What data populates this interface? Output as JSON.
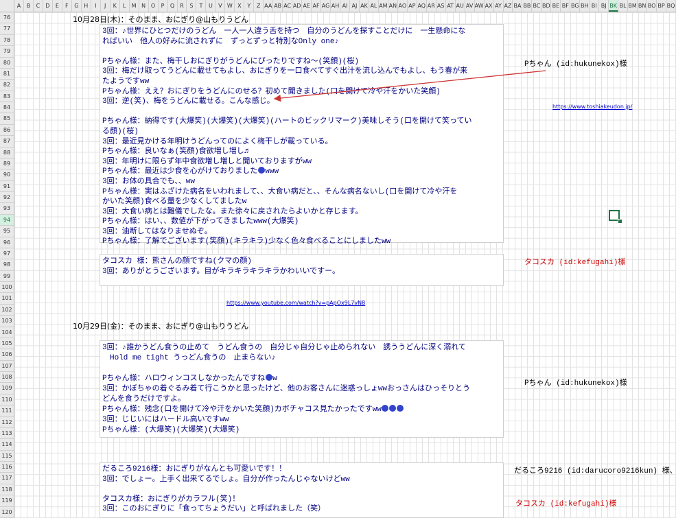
{
  "colors": {
    "accent": "#217346",
    "text_blue": "#000080",
    "name_red": "#cc0000",
    "link": "#0000cc",
    "arrow": "#cc3333"
  },
  "columns": [
    "A",
    "B",
    "C",
    "D",
    "E",
    "F",
    "G",
    "H",
    "I",
    "J",
    "K",
    "L",
    "M",
    "N",
    "O",
    "P",
    "Q",
    "R",
    "S",
    "T",
    "U",
    "V",
    "W",
    "X",
    "Y",
    "Z",
    "AA",
    "AB",
    "AC",
    "AD",
    "AE",
    "AF",
    "AG",
    "AH",
    "AI",
    "AJ",
    "AK",
    "AL",
    "AM",
    "AN",
    "AO",
    "AP",
    "AQ",
    "AR",
    "AS",
    "AT",
    "AU",
    "AV",
    "AW",
    "AX",
    "AY",
    "AZ",
    "BA",
    "BB",
    "BC",
    "BD",
    "BE",
    "BF",
    "BG",
    "BH",
    "BI",
    "BJ",
    "BK",
    "BL",
    "BM",
    "BN",
    "BO",
    "BP",
    "BQ"
  ],
  "selected_column": "BK",
  "rows": [
    "76",
    "77",
    "78",
    "79",
    "80",
    "81",
    "82",
    "83",
    "84",
    "85",
    "86",
    "87",
    "88",
    "89",
    "90",
    "91",
    "92",
    "93",
    "94",
    "95",
    "96",
    "97",
    "98",
    "99",
    "100",
    "101",
    "102",
    "103",
    "104",
    "105",
    "106",
    "107",
    "108",
    "109",
    "110",
    "111",
    "112",
    "113",
    "114",
    "115",
    "116",
    "117",
    "118",
    "119",
    "120"
  ],
  "selected_row": "94",
  "headings": {
    "day1": "10月28日(木)：そのまま、おにぎり@山もりうどん",
    "day2": "10月29日(金)：そのまま、おにぎり@山もりうどん"
  },
  "block1": [
    "3回：♪世界にひとつだけのうどん　一人一人違う舌を持つ　自分のうどんを探すことだけに　一生懸命にな",
    "ればいい　他人の好みに流されずに　ずっとずっと特別なOnly one♪",
    "",
    "Pちゃん様：また、梅干しおにぎりがうどんにぴったりですね～(笑顔)(桜)",
    "3回：梅だけ取ってうどんに載せてもよし、おにぎりを一口食べてすぐ出汁を流し込んでもよし、もう春が来",
    "たようですww",
    "Pちゃん様：ええ？おにぎりをうどんにのせる？初めて聞きました(口を開けて冷や汗をかいた笑顔)",
    "3回：逆(笑)、梅をうどんに載せる。こんな感じ。",
    "",
    "Pちゃん様：納得です(大爆笑)(大爆笑)(大爆笑)(ハートのビックリマーク)美味しそう(口を開けて笑ってい",
    "る顔)(桜)",
    "3回：最近見かける年明けうどんってのによく梅干しが載っている。",
    "Pちゃん様：良いなぁ(笑顔)食欲増し増し♬",
    "3回：年明けに限らず年中食欲増し増しと聞いておりますがww",
    "Pちゃん様：最近は少食を心がけておりました{emo}www",
    "3回：お体の具合でも、、ww",
    "Pちゃん様：実はふざけた病名をいわれまして、、大食い病だと、、そんな病名ないし(口を開けて冷や汗を",
    "かいた笑顔)食べる量を少なくしてましたw",
    "3回：大食い病とは難儀でしたな。また徐々に戻されたらよいかと存じます。",
    "Pちゃん様：はい、、数値が下がってきましたwww(大爆笑)",
    "3回：油断してはなりませぬぞ。",
    "Pちゃん様：了解でございます(笑顔)(キラキラ)少なく色々食べることにしましたww"
  ],
  "block2": [
    "タコスカ 様：熊さんの顔ですね(クマの顔)",
    "3回：ありがとうございます。目がキラキラキラキラかわいいですー。"
  ],
  "block3": [
    "3回：♪誰かうどん食うの止めて　うどん食うの　自分じゃ自分じゃ止められない　誘ううどんに深く溺れて",
    "　Hold me tight うっどん食うの　止まらない♪",
    "",
    "Pちゃん様：ハロウィンコスしなかったんですね{emo}w",
    "3回：かぼちゃの着ぐるみ着て行こうかと思ったけど、他のお客さんに迷惑っしょwwおっさんはひっそりとう",
    "どんを食うだけですよ。",
    "Pちゃん様：残念(口を開けて冷や汗をかいた笑顔)カボチャコス見たかったですww{emo}{emo}{emo}",
    "3回：じじいにはハードル高いですww",
    "Pちゃん様：(大爆笑)(大爆笑)(大爆笑)"
  ],
  "block4": [
    "だるころ9216様：おにぎりがなんとも可愛いです！！",
    "3回：でしょー。上手く出来てるでしょ。自分が作ったんじゃないけどww",
    "",
    "タコスカ様：おにぎりがカラフル(笑)！",
    "3回：このおにぎりに「食ってちょうだい」と呼ばれました（笑）"
  ],
  "links": {
    "toshiake": "https://www.toshiakeudon.jp/",
    "youtube": "https://www.youtube.com/watch?v=pApOx9L7vN8"
  },
  "names": {
    "p1": "Pちゃん (id:hukunekox)様",
    "tako1": "タコスカ (id:kefugahi)様",
    "p2": "Pちゃん (id:hukunekox)様",
    "daru": "だるころ9216 (id:darucoro9216kun) 様、",
    "tako2": "タコスカ (id:kefugahi)様"
  }
}
